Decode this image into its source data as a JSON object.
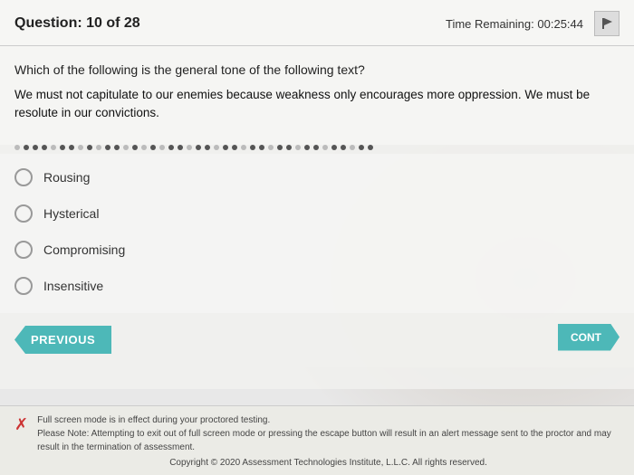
{
  "header": {
    "question_counter": "Question: 10 of 28",
    "time_label": "Time Remaining:",
    "time_value": "00:25:44",
    "flag_icon": "flag"
  },
  "question": {
    "prompt": "Which of the following is the general tone of the following text?",
    "text": "We must not capitulate to our enemies because weakness only encourages more oppression. We must be resolute in our convictions."
  },
  "options": [
    {
      "id": "opt1",
      "label": "Rousing",
      "selected": false
    },
    {
      "id": "opt2",
      "label": "Hysterical",
      "selected": false
    },
    {
      "id": "opt3",
      "label": "Compromising",
      "selected": false
    },
    {
      "id": "opt4",
      "label": "Insensitive",
      "selected": false
    }
  ],
  "buttons": {
    "previous": "PREVIOUS",
    "continue": "CONT"
  },
  "footer": {
    "line1": "Full screen mode is in effect during your proctored testing.",
    "line2": "Please Note: Attempting to exit out of full screen mode or pressing the escape button will result in an alert message sent to the proctor and may result in the termination of assessment.",
    "copyright": "Copyright © 2020 Assessment Technologies Institute, L.L.C. All rights reserved."
  }
}
